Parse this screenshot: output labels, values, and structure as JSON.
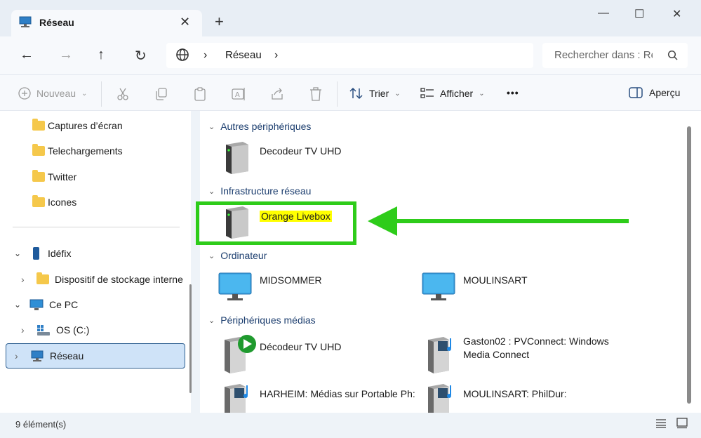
{
  "tab": {
    "title": "Réseau",
    "close": "✕",
    "new": "+"
  },
  "window": {
    "minimize": "—",
    "maximize": "☐",
    "close": "✕"
  },
  "nav": {
    "back": "←",
    "forward": "→",
    "up": "↑",
    "refresh": "↻"
  },
  "address": {
    "sep1": "›",
    "crumb": "Réseau",
    "sep2": "›"
  },
  "search": {
    "placeholder": "Rechercher dans : Ré"
  },
  "toolbar": {
    "new_label": "Nouveau",
    "sort_label": "Trier",
    "view_label": "Afficher",
    "more_label": "•••",
    "preview_label": "Aperçu"
  },
  "sidebar": {
    "items": [
      {
        "label": "Captures d’écran"
      },
      {
        "label": "Telechargements"
      },
      {
        "label": "Twitter"
      },
      {
        "label": "Icones"
      },
      {
        "label": "Idéfix"
      },
      {
        "label": "Dispositif de stockage interne"
      },
      {
        "label": "Ce PC"
      },
      {
        "label": "OS (C:)"
      },
      {
        "label": "Réseau"
      }
    ]
  },
  "groups": [
    {
      "title": "Autres périphériques",
      "items": [
        {
          "label": "Decodeur TV UHD"
        }
      ]
    },
    {
      "title": "Infrastructure réseau",
      "items": [
        {
          "label": "Orange Livebox"
        }
      ]
    },
    {
      "title": "Ordinateur",
      "items": [
        {
          "label": "MIDSOMMER"
        },
        {
          "label": "MOULINSART"
        }
      ]
    },
    {
      "title": "Périphériques médias",
      "items": [
        {
          "label": "Décodeur TV UHD"
        },
        {
          "label": "Gaston02 : PVConnect: Windows Media Connect"
        },
        {
          "label": "HARHEIM: Médias sur Portable Ph:"
        },
        {
          "label": "MOULINSART: PhilDur:"
        }
      ]
    }
  ],
  "status": {
    "count": "9 élément(s)"
  },
  "colors": {
    "annotation": "#2ecc1a",
    "highlight": "#ffff00",
    "selection": "#cfe3f8"
  },
  "icons": [
    "network-icon",
    "globe-icon",
    "folder-icon",
    "phone-icon",
    "computer-icon",
    "drive-icon",
    "device-box-icon",
    "monitor-icon",
    "media-device-icon"
  ]
}
